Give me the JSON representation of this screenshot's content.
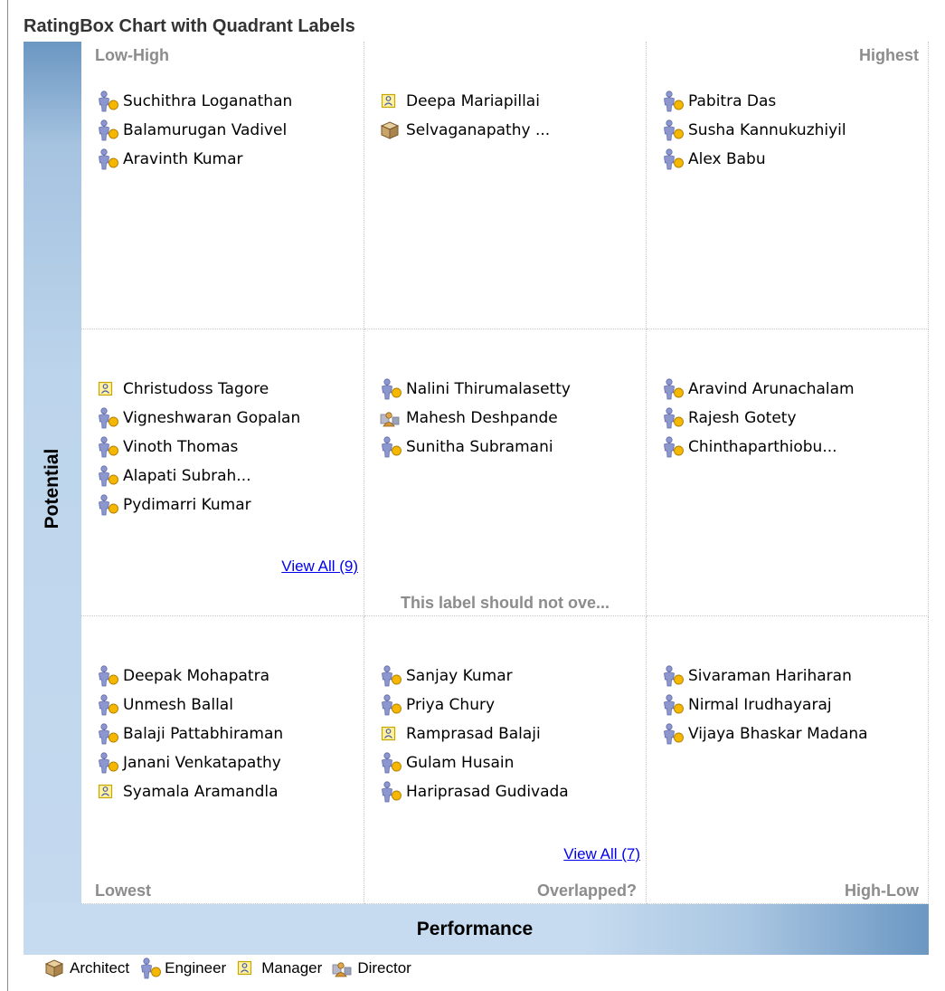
{
  "chart_data": {
    "type": "table",
    "title": "RatingBox Chart with Quadrant Labels",
    "xlabel": "Performance",
    "ylabel": "Potential",
    "rows": [
      {
        "cells": [
          {
            "label_left": "Low-High",
            "label_right": "",
            "items": [
              {
                "name": "Suchithra Loganathan",
                "icon": "engineer-icon"
              },
              {
                "name": "Balamurugan Vadivel",
                "icon": "engineer-icon"
              },
              {
                "name": "Aravinth Kumar",
                "icon": "engineer-icon"
              }
            ],
            "view_all": ""
          },
          {
            "label_left": "",
            "label_right": "",
            "items": [
              {
                "name": "Deepa Mariapillai",
                "icon": "manager-icon"
              },
              {
                "name": "Selvaganapathy ...",
                "icon": "architect-icon"
              }
            ],
            "view_all": ""
          },
          {
            "label_left": "",
            "label_right": "Highest",
            "items": [
              {
                "name": "Pabitra Das",
                "icon": "engineer-icon"
              },
              {
                "name": "Susha Kannukuzhiyil",
                "icon": "engineer-icon"
              },
              {
                "name": "Alex Babu",
                "icon": "engineer-icon"
              }
            ],
            "view_all": ""
          }
        ]
      },
      {
        "cells": [
          {
            "label_left": "",
            "label_right": "",
            "items": [
              {
                "name": "Christudoss Tagore",
                "icon": "manager-icon"
              },
              {
                "name": "Vigneshwaran Gopalan",
                "icon": "engineer-icon"
              },
              {
                "name": "Vinoth Thomas",
                "icon": "engineer-icon"
              },
              {
                "name": "Alapati Subrah...",
                "icon": "engineer-icon"
              },
              {
                "name": "Pydimarri Kumar",
                "icon": "engineer-icon"
              }
            ],
            "view_all": "View All (9)"
          },
          {
            "label_left": "",
            "label_right": "",
            "label_bottom": "This label should not ove...",
            "items": [
              {
                "name": "Nalini Thirumalasetty",
                "icon": "engineer-icon"
              },
              {
                "name": "Mahesh Deshpande",
                "icon": "director-icon"
              },
              {
                "name": "Sunitha Subramani",
                "icon": "engineer-icon"
              }
            ],
            "view_all": ""
          },
          {
            "label_left": "",
            "label_right": "",
            "items": [
              {
                "name": "Aravind Arunachalam",
                "icon": "engineer-icon"
              },
              {
                "name": "Rajesh Gotety",
                "icon": "engineer-icon"
              },
              {
                "name": "Chinthaparthiobu...",
                "icon": "engineer-icon"
              }
            ],
            "view_all": ""
          }
        ]
      },
      {
        "cells": [
          {
            "label_left": "Lowest",
            "label_right": "",
            "items": [
              {
                "name": "Deepak Mohapatra",
                "icon": "engineer-icon"
              },
              {
                "name": "Unmesh Ballal",
                "icon": "engineer-icon"
              },
              {
                "name": "Balaji Pattabhiraman",
                "icon": "engineer-icon"
              },
              {
                "name": "Janani Venkatapathy",
                "icon": "engineer-icon"
              },
              {
                "name": "Syamala Aramandla",
                "icon": "manager-icon"
              }
            ],
            "view_all": ""
          },
          {
            "label_left": "",
            "label_right": "Overlapped?",
            "items": [
              {
                "name": "Sanjay Kumar",
                "icon": "engineer-icon"
              },
              {
                "name": "Priya Chury",
                "icon": "engineer-icon"
              },
              {
                "name": "Ramprasad Balaji",
                "icon": "manager-icon"
              },
              {
                "name": "Gulam Husain",
                "icon": "engineer-icon"
              },
              {
                "name": "Hariprasad Gudivada",
                "icon": "engineer-icon"
              }
            ],
            "view_all": "View All (7)"
          },
          {
            "label_left": "",
            "label_right": "High-Low",
            "items": [
              {
                "name": "Sivaraman Hariharan",
                "icon": "engineer-icon"
              },
              {
                "name": "Nirmal Irudhayaraj",
                "icon": "engineer-icon"
              },
              {
                "name": "Vijaya Bhaskar Madana",
                "icon": "engineer-icon"
              }
            ],
            "view_all": ""
          }
        ]
      }
    ],
    "legend": [
      {
        "label": "Architect",
        "icon": "architect-icon"
      },
      {
        "label": "Engineer",
        "icon": "engineer-icon"
      },
      {
        "label": "Manager",
        "icon": "manager-icon"
      },
      {
        "label": "Director",
        "icon": "director-icon"
      }
    ],
    "colors": {
      "axis_band": "#c6dbef",
      "axis_band_dark": "#6b97c2",
      "quadrant_label": "#8c8c8c",
      "link": "#0000ee",
      "engineer_figure": "#8d97cf",
      "engineer_badge": "#f5b700",
      "manager_badge_fill": "#fff3a0",
      "manager_badge_border": "#c9a500",
      "architect_box": "#c9a56b"
    }
  }
}
